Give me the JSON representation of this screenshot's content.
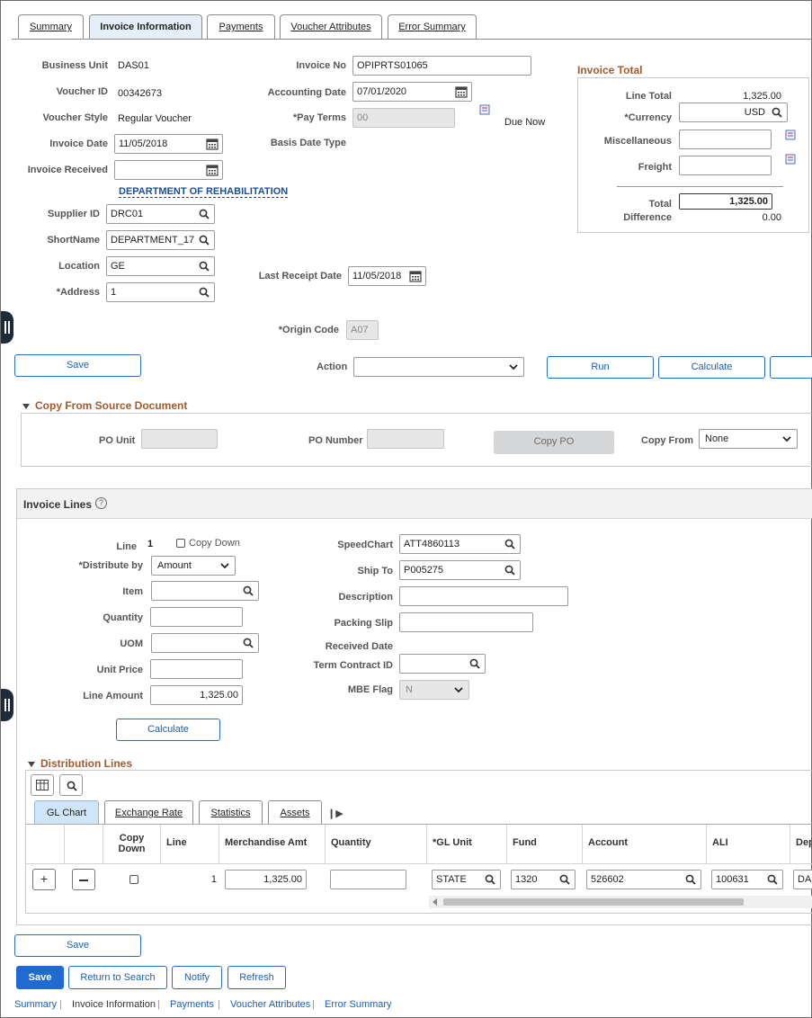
{
  "tabs": [
    "Summary",
    "Invoice Information",
    "Payments",
    "Voucher Attributes",
    "Error Summary"
  ],
  "header": {
    "business_unit_label": "Business Unit",
    "business_unit": "DAS01",
    "voucher_id_label": "Voucher ID",
    "voucher_id": "00342673",
    "voucher_style_label": "Voucher Style",
    "voucher_style": "Regular Voucher",
    "invoice_date_label": "Invoice Date",
    "invoice_date": "11/05/2018",
    "invoice_received_label": "Invoice Received",
    "invoice_received": "",
    "supplier_name": "DEPARTMENT OF REHABILITATION",
    "supplier_id_label": "Supplier ID",
    "supplier_id": "DRC01",
    "shortname_label": "ShortName",
    "shortname": "DEPARTMENT_17",
    "location_label": "Location",
    "location": "GE",
    "address_label": "*Address",
    "address": "1",
    "invoice_no_label": "Invoice No",
    "invoice_no": "OPIPRTS01065",
    "accounting_date_label": "Accounting Date",
    "accounting_date": "07/01/2020",
    "pay_terms_label": "*Pay Terms",
    "pay_terms": "00",
    "pay_terms_desc": "Due Now",
    "basis_date_type_label": "Basis Date Type",
    "last_receipt_date_label": "Last Receipt Date",
    "last_receipt_date": "11/05/2018",
    "origin_code_label": "*Origin Code",
    "origin_code": "A07"
  },
  "invoice_total": {
    "title": "Invoice Total",
    "line_total_label": "Line Total",
    "line_total": "1,325.00",
    "currency_label": "*Currency",
    "currency": "USD",
    "misc_label": "Miscellaneous",
    "freight_label": "Freight",
    "total_label": "Total",
    "total": "1,325.00",
    "difference_label": "Difference",
    "difference": "0.00"
  },
  "action_bar": {
    "save": "Save",
    "action_label": "Action",
    "action_value": "",
    "run": "Run",
    "calculate": "Calculate"
  },
  "copy_from": {
    "title": "Copy From Source Document",
    "po_unit_label": "PO Unit",
    "po_number_label": "PO Number",
    "copy_po": "Copy PO",
    "copy_from_label": "Copy From",
    "copy_from_value": "None"
  },
  "invoice_lines": {
    "title": "Invoice Lines",
    "line_label": "Line",
    "line": "1",
    "copy_down_label": "Copy Down",
    "distribute_by_label": "*Distribute by",
    "distribute_by": "Amount",
    "item_label": "Item",
    "quantity_label": "Quantity",
    "uom_label": "UOM",
    "unit_price_label": "Unit Price",
    "line_amount_label": "Line Amount",
    "line_amount": "1,325.00",
    "calculate": "Calculate",
    "speedchart_label": "SpeedChart",
    "speedchart": "ATT4860113",
    "ship_to_label": "Ship To",
    "ship_to": "P005275",
    "description_label": "Description",
    "packing_slip_label": "Packing Slip",
    "received_date_label": "Received Date",
    "term_contract_label": "Term Contract ID",
    "mbe_flag_label": "MBE Flag",
    "mbe_flag": "N"
  },
  "distribution": {
    "title": "Distribution Lines",
    "tabs": [
      "GL Chart",
      "Exchange Rate",
      "Statistics",
      "Assets"
    ],
    "columns": [
      "Copy Down",
      "Line",
      "Merchandise Amt",
      "Quantity",
      "*GL Unit",
      "Fund",
      "Account",
      "ALI",
      "Dep"
    ],
    "row": {
      "line": "1",
      "merch_amt": "1,325.00",
      "gl_unit": "STATE",
      "fund": "1320",
      "account": "526602",
      "ali": "100631",
      "dept": "DA"
    }
  },
  "bottom": {
    "save": "Save",
    "save_primary": "Save",
    "return_to_search": "Return to Search",
    "notify": "Notify",
    "refresh": "Refresh",
    "links": [
      "Summary",
      "Invoice Information",
      "Payments",
      "Voucher Attributes",
      "Error Summary"
    ]
  }
}
